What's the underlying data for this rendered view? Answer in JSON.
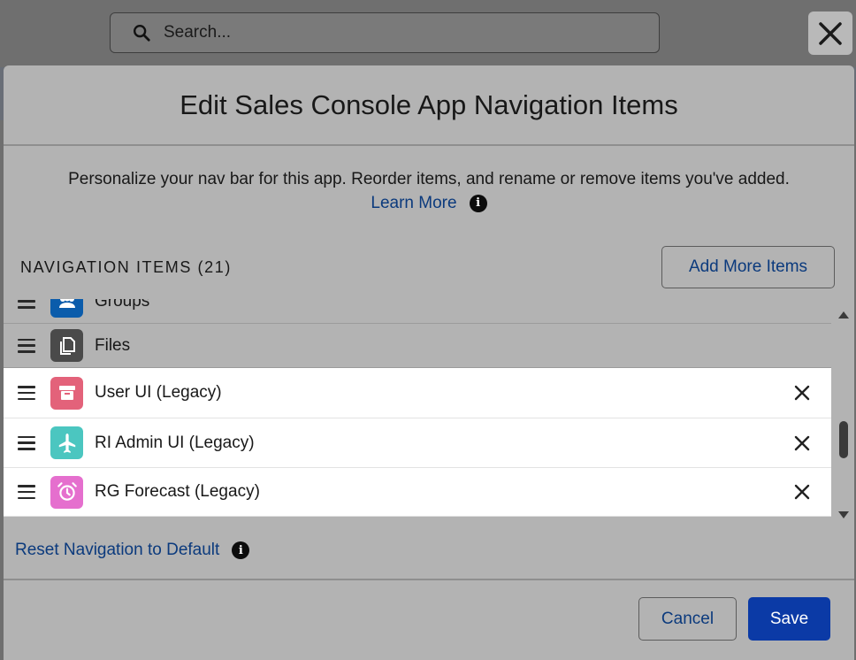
{
  "search": {
    "placeholder": "Search..."
  },
  "modal": {
    "title": "Edit Sales Console App Navigation Items",
    "description": "Personalize your nav bar for this app. Reorder items, and rename or remove items you've added.",
    "learn_more": "Learn More",
    "section_title": "Navigation Items (21)",
    "add_more_label": "Add More Items",
    "reset_label": "Reset Navigation to Default",
    "cancel_label": "Cancel",
    "save_label": "Save"
  },
  "nav_items": [
    {
      "label": "Groups",
      "icon": "groups-icon",
      "color": "#0b5cab",
      "removable": false
    },
    {
      "label": "Files",
      "icon": "files-icon",
      "color": "#4a4a4a",
      "removable": false
    },
    {
      "label": "User UI (Legacy)",
      "icon": "archive-box-icon",
      "color": "#e3627a",
      "removable": true
    },
    {
      "label": "RI Admin UI (Legacy)",
      "icon": "airplane-icon",
      "color": "#4bc6c0",
      "removable": true
    },
    {
      "label": "RG Forecast (Legacy)",
      "icon": "alarm-clock-icon",
      "color": "#e56fce",
      "removable": true
    }
  ],
  "colors": {
    "link": "#0b3a7d",
    "brand": "#0b3aa6"
  }
}
